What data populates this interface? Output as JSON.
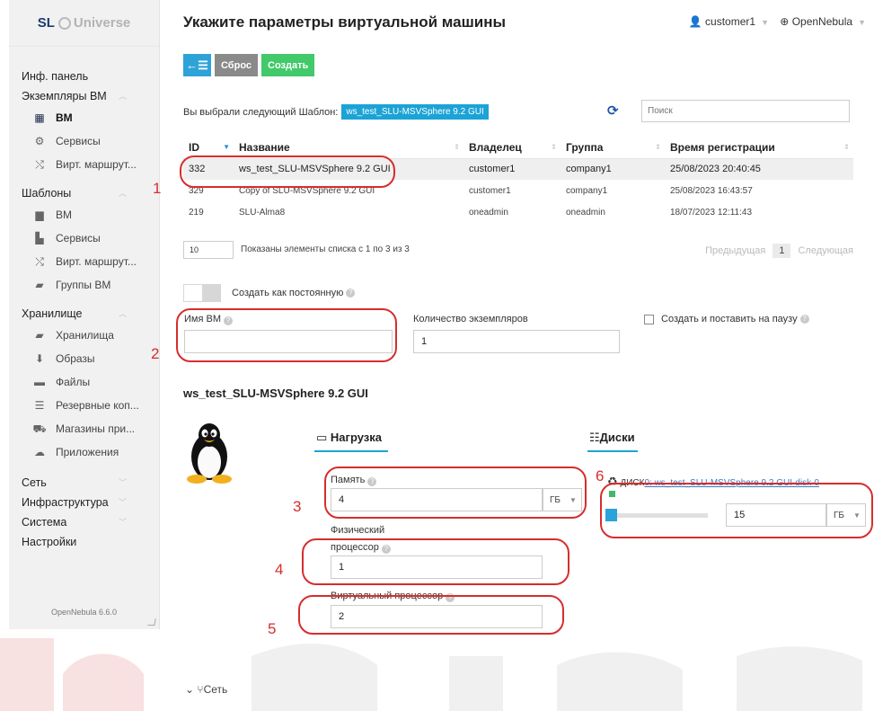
{
  "sidebar": {
    "logo_sl": "SL",
    "logo_text": "Universe",
    "groups": {
      "dashboard": "Инф. панель",
      "instances": "Экземпляры ВМ",
      "templates": "Шаблоны",
      "storage": "Хранилище",
      "network": "Сеть",
      "infra": "Инфраструктура",
      "system": "Система",
      "settings": "Настройки"
    },
    "items": {
      "vm": "ВМ",
      "services": "Сервисы",
      "vrouters": "Вирт. маршрут...",
      "tpl_vm": "ВМ",
      "tpl_services": "Сервисы",
      "tpl_vrouters": "Вирт. маршрут...",
      "vm_groups": "Группы ВМ",
      "datastores": "Хранилища",
      "images": "Образы",
      "files": "Файлы",
      "backups": "Резервные коп...",
      "marketplaces": "Магазины при...",
      "apps": "Приложения"
    },
    "version": "OpenNebula 6.6.0"
  },
  "header": {
    "title": "Укажите параметры виртуальной машины",
    "user": "customer1",
    "cloud": "OpenNebula"
  },
  "toolbar": {
    "back": "←☰",
    "reset": "Сброс",
    "create": "Создать"
  },
  "selection": {
    "label": "Вы выбрали следующий Шаблон:",
    "template": "ws_test_SLU-MSVSphere 9.2 GUI",
    "search_placeholder": "Поиск"
  },
  "table": {
    "headers": [
      "ID",
      "Название",
      "Владелец",
      "Группа",
      "Время регистрации"
    ],
    "rows": [
      [
        "332",
        "ws_test_SLU-MSVSphere 9.2 GUI",
        "customer1",
        "company1",
        "25/08/2023 20:40:45"
      ],
      [
        "329",
        "Copy of SLU-MSVSphere 9.2 GUI",
        "customer1",
        "company1",
        "25/08/2023 16:43:57"
      ],
      [
        "219",
        "SLU-Alma8",
        "oneadmin",
        "oneadmin",
        "18/07/2023 12:11:43"
      ]
    ]
  },
  "pager": {
    "size": "10",
    "info": "Показаны элементы списка с 1 по 3 из 3",
    "prev": "Предыдущая",
    "current": "1",
    "next": "Следующая"
  },
  "form": {
    "persistent_label": "Создать как постоянную",
    "vm_name_label": "Имя ВМ",
    "vm_name_value": "",
    "instances_label": "Количество экземпляров",
    "instances_value": "1",
    "hold_label": "Создать и поставить на паузу",
    "template_name": "ws_test_SLU-MSVSphere 9.2 GUI",
    "capacity_tab": "Нагрузка",
    "disks_tab": "Диски",
    "memory_label": "Память",
    "memory_value": "4",
    "memory_unit": "ГБ",
    "cpu_label_1": "Физический",
    "cpu_label_2": "процессор",
    "cpu_value": "1",
    "vcpu_label": "Виртуальный процессор",
    "vcpu_value": "2",
    "disk_prefix": "ДИСК",
    "disk_link": "0: ws_test_SLU-MSVSphere 9.2 GUI-disk-0",
    "disk_size": "15",
    "disk_unit": "ГБ",
    "network_section": "Сеть"
  },
  "annotations": [
    "1",
    "2",
    "3",
    "4",
    "5",
    "6"
  ]
}
